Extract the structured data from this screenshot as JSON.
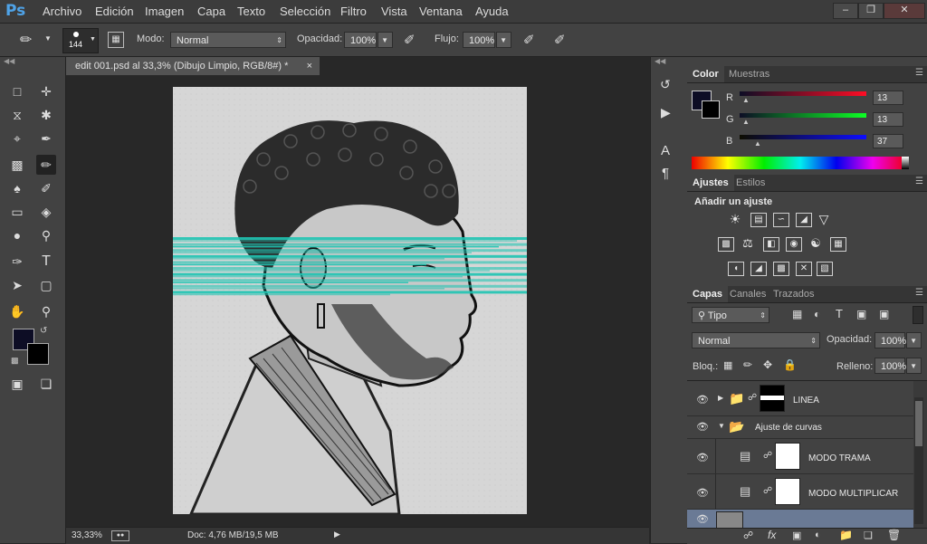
{
  "app": {
    "logo": "Ps"
  },
  "menu": [
    "Archivo",
    "Edición",
    "Imagen",
    "Capa",
    "Texto",
    "Selección",
    "Filtro",
    "Vista",
    "Ventana",
    "Ayuda"
  ],
  "options": {
    "brush_size": "144",
    "mode_label": "Modo:",
    "mode_value": "Normal",
    "opacity_label": "Opacidad:",
    "opacity_value": "100%",
    "flow_label": "Flujo:",
    "flow_value": "100%"
  },
  "document": {
    "tab_title": "edit 001.psd al 33,3% (Dibujo Limpio, RGB/8#) *",
    "close_glyph": "×",
    "zoom": "33,33%",
    "doc_info": "Doc: 4,76 MB/19,5 MB"
  },
  "color_panel": {
    "tabs": [
      "Color",
      "Muestras"
    ],
    "r_label": "R",
    "g_label": "G",
    "b_label": "B",
    "r_value": 13,
    "g_value": 13,
    "b_value": 37,
    "foreground": "#0d0d25",
    "background": "#000000"
  },
  "adjustments_panel": {
    "tabs": [
      "Ajustes",
      "Estilos"
    ],
    "heading": "Añadir un ajuste"
  },
  "layers_panel": {
    "tabs": [
      "Capas",
      "Canales",
      "Trazados"
    ],
    "filter_label": "Tipo",
    "blend_mode": "Normal",
    "opacity_label": "Opacidad:",
    "opacity_value": "100%",
    "lock_label": "Bloq.:",
    "fill_label": "Relleno:",
    "fill_value": "100%",
    "layers": [
      {
        "name": "LINEA"
      },
      {
        "name": "Ajuste de curvas"
      },
      {
        "name": "MODO TRAMA"
      },
      {
        "name": "MODO MULTIPLICAR"
      }
    ]
  },
  "colors": {
    "accent_cyan": "#1fc4b3",
    "panel": "#424242"
  }
}
